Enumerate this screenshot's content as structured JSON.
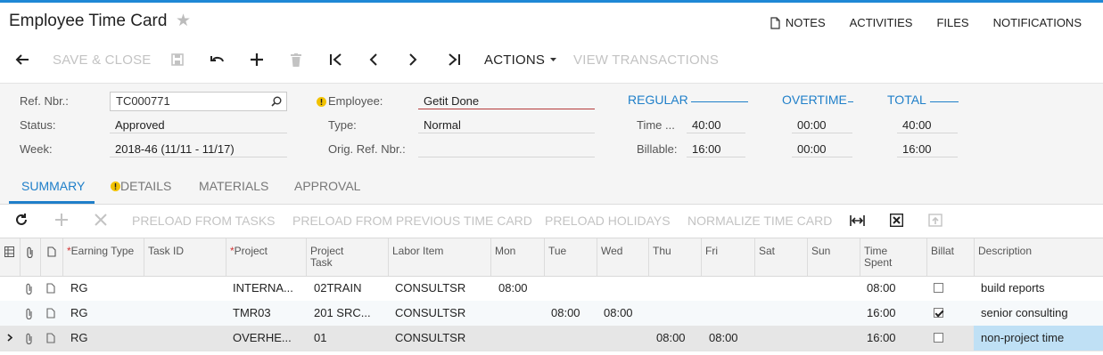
{
  "header": {
    "title": "Employee Time Card",
    "links": [
      "NOTES",
      "ACTIVITIES",
      "FILES",
      "NOTIFICATIONS"
    ]
  },
  "toolbar": {
    "save_close": "SAVE & CLOSE",
    "actions": "ACTIONS",
    "view_transactions": "VIEW TRANSACTIONS"
  },
  "form": {
    "ref_label": "Ref. Nbr.:",
    "ref_value": "TC000771",
    "status_label": "Status:",
    "status_value": "Approved",
    "week_label": "Week:",
    "week_value": "2018-46 (11/11 - 11/17)",
    "employee_label": "Employee:",
    "employee_value": "Getit Done",
    "type_label": "Type:",
    "type_value": "Normal",
    "orig_label": "Orig. Ref. Nbr.:",
    "orig_value": ""
  },
  "summary_totals": {
    "regular_title": "REGULAR",
    "overtime_title": "OVERTIME",
    "total_title": "TOTAL",
    "time_label": "Time ...",
    "billable_label": "Billable:",
    "regular_time": "40:00",
    "regular_billable": "16:00",
    "overtime_time": "00:00",
    "overtime_billable": "00:00",
    "total_time": "40:00",
    "total_billable": "16:00"
  },
  "tabs": [
    "SUMMARY",
    "DETAILS",
    "MATERIALS",
    "APPROVAL"
  ],
  "grid_toolbar": {
    "preload_tasks": "PRELOAD FROM TASKS",
    "preload_prev": "PRELOAD FROM PREVIOUS TIME CARD",
    "preload_holidays": "PRELOAD HOLIDAYS",
    "normalize": "NORMALIZE TIME CARD"
  },
  "grid": {
    "columns": {
      "earning_type": "Earning Type",
      "task_id": "Task ID",
      "project": "Project",
      "project_task": "Project Task",
      "labor_item": "Labor Item",
      "mon": "Mon",
      "tue": "Tue",
      "wed": "Wed",
      "thu": "Thu",
      "fri": "Fri",
      "sat": "Sat",
      "sun": "Sun",
      "time_spent": "Time Spent",
      "billable": "Billat",
      "description": "Description"
    },
    "rows": [
      {
        "earning": "RG",
        "task": "",
        "project": "INTERNA...",
        "ptask": "02TRAIN",
        "labor": "CONSULTSR",
        "mon": "08:00",
        "tue": "",
        "wed": "",
        "thu": "",
        "fri": "",
        "sat": "",
        "sun": "",
        "spent": "08:00",
        "billable": false,
        "desc": "build reports"
      },
      {
        "earning": "RG",
        "task": "",
        "project": "TMR03",
        "ptask": "201 SRC...",
        "labor": "CONSULTSR",
        "mon": "",
        "tue": "08:00",
        "wed": "08:00",
        "thu": "",
        "fri": "",
        "sat": "",
        "sun": "",
        "spent": "16:00",
        "billable": true,
        "desc": "senior consulting"
      },
      {
        "earning": "RG",
        "task": "",
        "project": "OVERHE...",
        "ptask": "01",
        "labor": "CONSULTSR",
        "mon": "",
        "tue": "",
        "wed": "",
        "thu": "08:00",
        "fri": "08:00",
        "sat": "",
        "sun": "",
        "spent": "16:00",
        "billable": false,
        "desc": "non-project time"
      }
    ]
  },
  "colors": {
    "accent": "#1f7fc9",
    "required": "#d23535",
    "selected_cell": "#bfe0f5"
  }
}
